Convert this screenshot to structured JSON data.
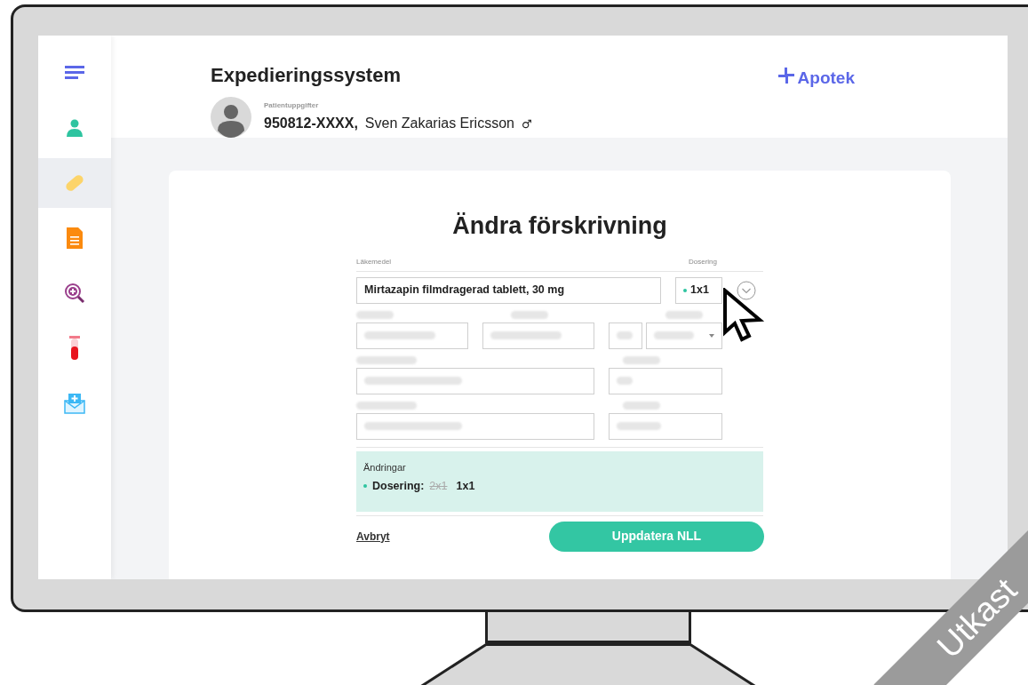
{
  "header": {
    "title": "Expedieringssystem",
    "patient_label": "Patientuppgifter",
    "patient_id": "950812-XXXX,",
    "patient_name": "Sven Zakarias Ericsson",
    "gender_symbol": "♂",
    "brand": "Apotek"
  },
  "sidebar": {
    "items": [
      {
        "kind": "menu",
        "selected": false
      },
      {
        "kind": "person",
        "selected": false
      },
      {
        "kind": "pill",
        "selected": true
      },
      {
        "kind": "document",
        "selected": false
      },
      {
        "kind": "magnifier",
        "selected": false
      },
      {
        "kind": "test-tube",
        "selected": false
      },
      {
        "kind": "mail",
        "selected": false
      }
    ]
  },
  "dialog": {
    "title": "Ändra förskrivning",
    "medicine_label": "Läkemedel",
    "dosage_label": "Dosering",
    "medicine_value": "Mirtazapin filmdragerad tablett, 30 mg",
    "dosage_value": "1x1",
    "changes": {
      "heading": "Ändringar",
      "items": [
        {
          "label": "Dosering:",
          "old": "2x1",
          "new": "1x1"
        }
      ]
    },
    "cancel": "Avbryt",
    "submit": "Uppdatera NLL"
  },
  "ribbon": "Utkast"
}
